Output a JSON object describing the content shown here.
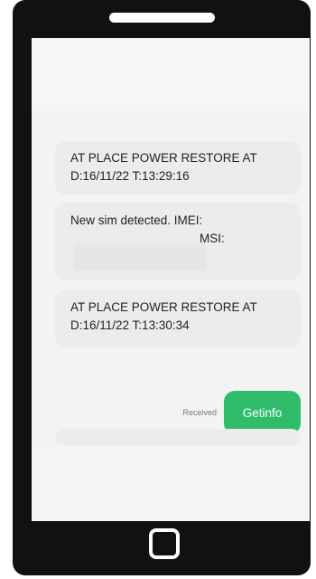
{
  "messages": [
    {
      "lines": [
        "AT PLACE POWER RESTORE AT",
        "D:16/11/22 T:13:29:16"
      ]
    },
    {
      "imei_label": "New sim detected. IMEI:",
      "msi_label": "MSI:"
    },
    {
      "lines": [
        "AT PLACE POWER RESTORE AT",
        "D:16/11/22 T:13:30:34"
      ]
    }
  ],
  "sent": {
    "status": "Received",
    "text": "Getinfo"
  },
  "colors": {
    "phone_body": "#111111",
    "screen_bg": "#f3f3f3",
    "incoming_bubble": "#ececec",
    "outgoing_bubble": "#2fbd6c"
  },
  "icons": {
    "speaker": "speaker-slot-icon",
    "home": "home-button-icon"
  }
}
